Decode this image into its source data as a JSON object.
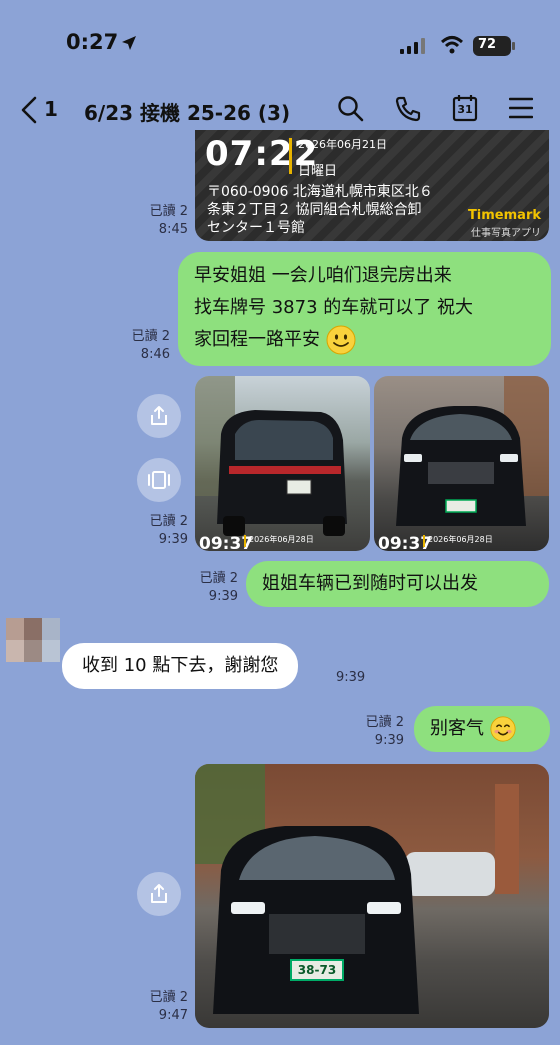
{
  "status": {
    "time": "0:27",
    "battery": "72"
  },
  "header": {
    "unread_count": "1",
    "title": "6/23 接機 25-26 (3)",
    "calendar_day": "31"
  },
  "messages": {
    "m1": {
      "read": "已讀 2",
      "time": "8:45",
      "photo": {
        "clock": "07:22",
        "date": "2026年06月21日",
        "weekday": "日曜日",
        "address_line1": "〒060-0906 北海道札幌市東区北６",
        "address_line2": "条東２丁目２ 協同組合札幌総合卸",
        "address_line3": "センター１号館",
        "brand": "Timemark",
        "brand_sub": "仕事写真アプリ"
      }
    },
    "m2": {
      "read": "已讀 2",
      "time": "8:46",
      "line1": "早安姐姐 一会儿咱们退完房出来",
      "line2": "找车牌号 3873 的车就可以了 祝大",
      "line3": "家回程一路平安"
    },
    "m3": {
      "read": "已讀 2",
      "time": "9:39",
      "left": {
        "clock": "09:37",
        "date": "2026年06月28日"
      },
      "right": {
        "clock": "09:37",
        "date": "2026年06月28日"
      }
    },
    "m4": {
      "read": "已讀 2",
      "time": "9:39",
      "text": "姐姐车辆已到随时可以出发"
    },
    "m5": {
      "time": "9:39",
      "text": "收到 10 點下去，謝謝您"
    },
    "m6": {
      "read": "已讀 2",
      "time": "9:39",
      "text": "别客气"
    },
    "m7": {
      "read": "已讀 2",
      "time": "9:47",
      "plate": "38-73"
    }
  },
  "colors": {
    "background": "#8ca3d6",
    "bubble_green": "#8ee07e",
    "bubble_white": "#ffffff"
  }
}
